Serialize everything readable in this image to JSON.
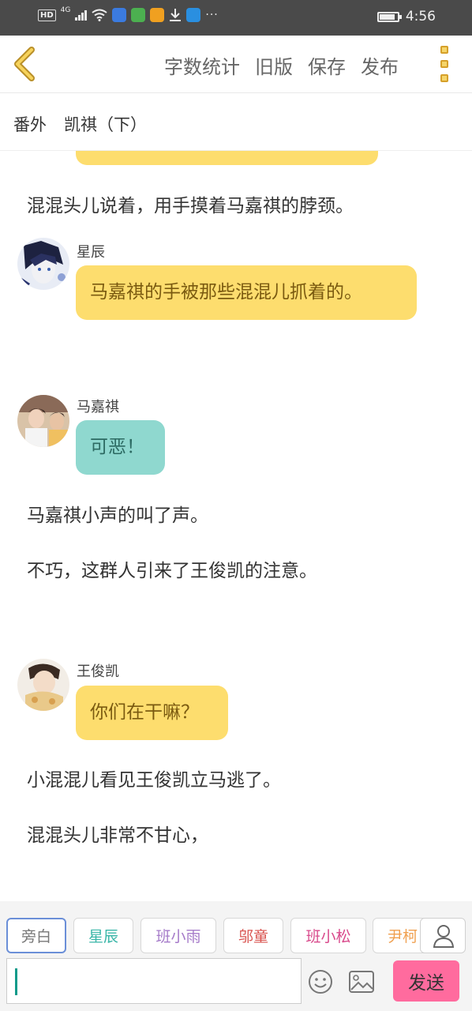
{
  "status_bar": {
    "hd": "HD",
    "network": "4G",
    "more_indicator": "···",
    "time": "4:56"
  },
  "header": {
    "actions": [
      "字数统计",
      "旧版",
      "保存",
      "发布"
    ]
  },
  "chapter": {
    "tag": "番外",
    "title": "凯祺（下）"
  },
  "messages": [
    {
      "type": "narration",
      "text": "混混头儿说着，用手摸着马嘉祺的脖颈。"
    },
    {
      "type": "dialog",
      "name": "星辰",
      "text": "马嘉祺的手被那些混混儿抓着的。",
      "color": "#fddd6e"
    },
    {
      "type": "dialog",
      "name": "马嘉祺",
      "text": "可恶！",
      "color": "#8fd8cf"
    },
    {
      "type": "narration",
      "text": "马嘉祺小声的叫了声。"
    },
    {
      "type": "narration",
      "text": "不巧，这群人引来了王俊凯的注意。"
    },
    {
      "type": "dialog",
      "name": "王俊凯",
      "text": "你们在干嘛？",
      "color": "#fddd6e"
    },
    {
      "type": "narration",
      "text": "小混混儿看见王俊凯立马逃了。"
    },
    {
      "type": "narration",
      "text": "混混头儿非常不甘心，"
    }
  ],
  "roles": [
    {
      "label": "旁白",
      "color": "#777777"
    },
    {
      "label": "星辰",
      "color": "#3ab6a8"
    },
    {
      "label": "班小雨",
      "color": "#a57ac9"
    },
    {
      "label": "邬童",
      "color": "#d9534f"
    },
    {
      "label": "班小松",
      "color": "#d94a8c"
    },
    {
      "label": "尹柯",
      "color": "#f0a050"
    }
  ],
  "composer": {
    "input_value": "",
    "send_label": "发送"
  },
  "icons": {
    "back": "chevron-left-icon",
    "more": "more-vertical-icon",
    "user": "user-icon",
    "emoji": "smiley-icon",
    "image": "image-icon"
  }
}
